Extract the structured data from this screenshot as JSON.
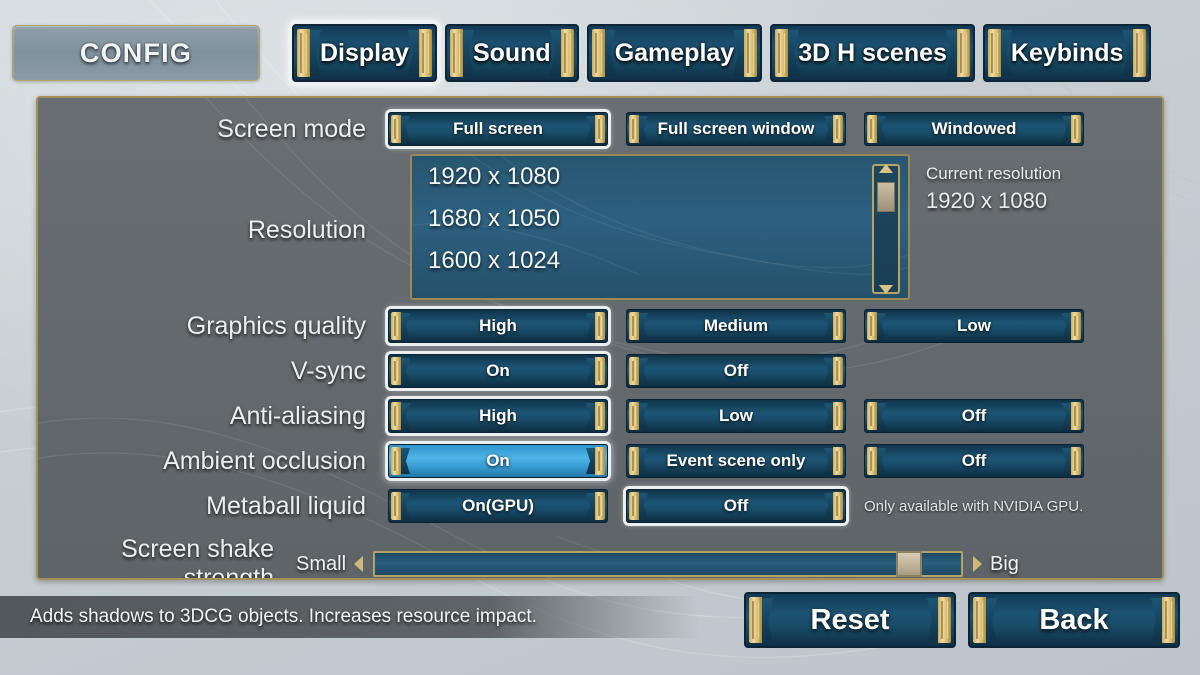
{
  "app": {
    "title": "CONFIG"
  },
  "colors": {
    "background": "#c6ced2",
    "panel": "#63696d",
    "gold": "#b8a360",
    "button_blue": "#1d5575",
    "highlight_blue": "#4fb4e6",
    "text": "#f0f4f6"
  },
  "tabs": [
    {
      "label": "Display",
      "selected": true
    },
    {
      "label": "Sound",
      "selected": false
    },
    {
      "label": "Gameplay",
      "selected": false
    },
    {
      "label": "3D H scenes",
      "selected": false
    },
    {
      "label": "Keybinds",
      "selected": false
    }
  ],
  "settings": {
    "screen_mode": {
      "label": "Screen mode",
      "options": [
        {
          "label": "Full screen",
          "state": "selected"
        },
        {
          "label": "Full screen window",
          "state": "normal"
        },
        {
          "label": "Windowed",
          "state": "normal"
        }
      ]
    },
    "resolution": {
      "label": "Resolution",
      "items": [
        "1920 x 1080",
        "1680 x 1050",
        "1600 x 1024"
      ],
      "current_label": "Current resolution",
      "current_value": "1920 x 1080",
      "scroll_position_percent": 8
    },
    "graphics_quality": {
      "label": "Graphics quality",
      "options": [
        {
          "label": "High",
          "state": "selected"
        },
        {
          "label": "Medium",
          "state": "normal"
        },
        {
          "label": "Low",
          "state": "normal"
        }
      ]
    },
    "vsync": {
      "label": "V-sync",
      "options": [
        {
          "label": "On",
          "state": "selected"
        },
        {
          "label": "Off",
          "state": "normal"
        },
        {
          "label": "",
          "state": "empty"
        }
      ]
    },
    "anti_aliasing": {
      "label": "Anti-aliasing",
      "options": [
        {
          "label": "High",
          "state": "selected"
        },
        {
          "label": "Low",
          "state": "normal"
        },
        {
          "label": "Off",
          "state": "normal"
        }
      ]
    },
    "ambient_occlusion": {
      "label": "Ambient occlusion",
      "options": [
        {
          "label": "On",
          "state": "hovered"
        },
        {
          "label": "Event scene only",
          "state": "normal"
        },
        {
          "label": "Off",
          "state": "normal"
        }
      ]
    },
    "metaball_liquid": {
      "label": "Metaball liquid",
      "options": [
        {
          "label": "On(GPU)",
          "state": "normal"
        },
        {
          "label": "Off",
          "state": "selected"
        }
      ],
      "note": "Only available with NVIDIA GPU."
    },
    "screen_shake": {
      "label": "Screen shake strength",
      "min_label": "Small",
      "max_label": "Big",
      "value_percent": 93
    }
  },
  "tooltip": {
    "text": "Adds shadows to 3DCG objects. Increases resource impact."
  },
  "footer": {
    "reset_label": "Reset",
    "back_label": "Back"
  }
}
